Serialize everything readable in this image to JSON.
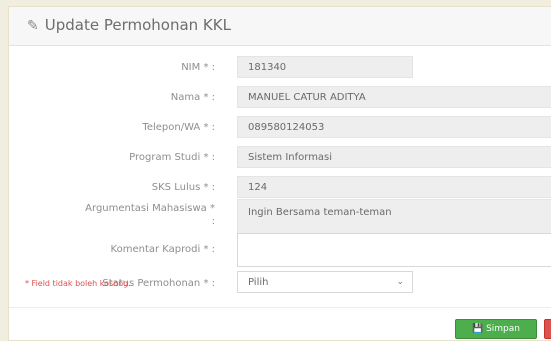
{
  "panel": {
    "title": "Update Permohonan KKL",
    "title_icon": "edit-icon"
  },
  "form": {
    "nim": {
      "label": "NIM * :",
      "value": "181340"
    },
    "nama": {
      "label": "Nama * :",
      "value": "MANUEL CATUR ADITYA"
    },
    "telepon": {
      "label": "Telepon/WA * :",
      "value": "089580124053"
    },
    "prodi": {
      "label": "Program Studi * :",
      "value": "Sistem Informasi"
    },
    "sks": {
      "label": "SKS Lulus * :",
      "value": "124"
    },
    "argumentasi": {
      "label": "Argumentasi Mahasiswa *",
      "label_colon": ":",
      "value": "Ingin Bersama teman-teman"
    },
    "komentar": {
      "label": "Komentar Kaprodi * :",
      "value": ""
    },
    "status": {
      "label": "Status Permohonan * :",
      "value": "Pilih"
    }
  },
  "note": "* Field tidak boleh kosong.",
  "buttons": {
    "save_label": "Simpan",
    "save_icon": "save-icon"
  },
  "colors": {
    "save": "#4cae4c",
    "cancel": "#d9534f",
    "note": "#d9534f"
  }
}
